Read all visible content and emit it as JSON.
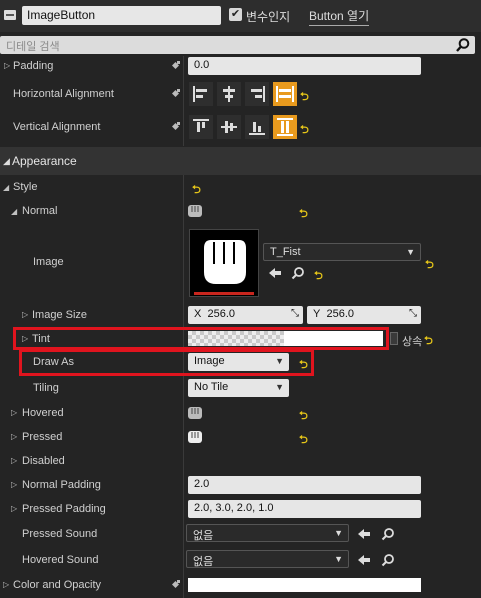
{
  "header": {
    "name_value": "ImageButton",
    "is_variable_checked": true,
    "is_variable_label": "변수인지",
    "open_button_label": "Button 열기"
  },
  "search": {
    "placeholder": "디테일 검색"
  },
  "rows": {
    "padding": {
      "label": "Padding",
      "value": "0.0"
    },
    "horizontal_alignment": {
      "label": "Horizontal Alignment"
    },
    "vertical_alignment": {
      "label": "Vertical Alignment"
    },
    "appearance": {
      "label": "Appearance"
    },
    "style": {
      "label": "Style"
    },
    "normal": {
      "label": "Normal"
    },
    "image": {
      "label": "Image",
      "asset_name": "T_Fist"
    },
    "image_size": {
      "label": "Image Size",
      "x_label": "X",
      "x_value": "256.0",
      "y_label": "Y",
      "y_value": "256.0"
    },
    "tint": {
      "label": "Tint",
      "inherit_label": "상속"
    },
    "draw_as": {
      "label": "Draw As",
      "value": "Image"
    },
    "tiling": {
      "label": "Tiling",
      "value": "No Tile"
    },
    "hovered": {
      "label": "Hovered"
    },
    "pressed": {
      "label": "Pressed"
    },
    "disabled": {
      "label": "Disabled"
    },
    "normal_padding": {
      "label": "Normal Padding",
      "value": "2.0"
    },
    "pressed_padding": {
      "label": "Pressed Padding",
      "value": "2.0, 3.0, 2.0, 1.0"
    },
    "pressed_sound": {
      "label": "Pressed Sound",
      "value": "없음"
    },
    "hovered_sound": {
      "label": "Hovered Sound",
      "value": "없음"
    },
    "color_and_opacity": {
      "label": "Color and Opacity"
    }
  },
  "colors": {
    "highlight_red": "#e0141e",
    "accent_orange": "#e89a1e",
    "reset_yellow": "#e6c619",
    "panel_bg": "#242424"
  },
  "icons": [
    "widget-icon",
    "check-icon",
    "search-icon",
    "keyframe-icon",
    "align-left-icon",
    "align-center-icon",
    "align-right-icon",
    "align-fill-icon",
    "align-top-icon",
    "align-middle-icon",
    "align-bottom-icon",
    "reset-arrow-icon",
    "fist-brush-icon",
    "use-selected-arrow-icon",
    "browse-icon",
    "expand-arrow-icon"
  ]
}
